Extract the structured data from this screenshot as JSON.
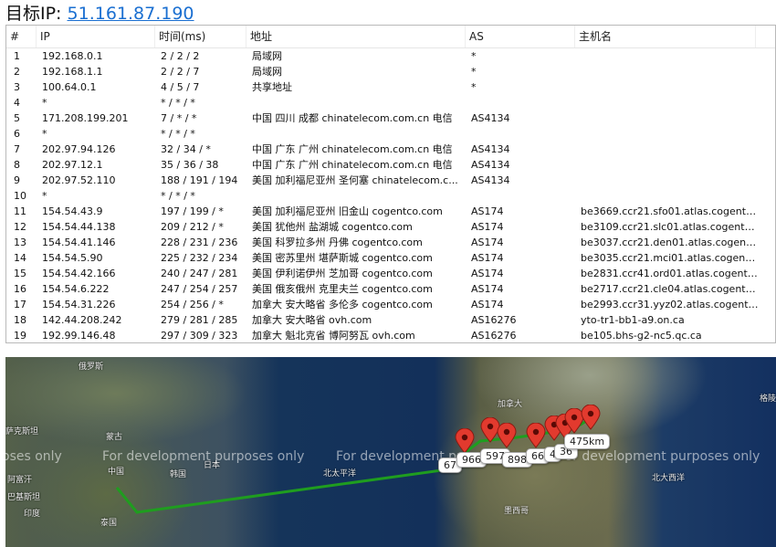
{
  "header": {
    "label": "目标IP:",
    "ip": "51.161.87.190"
  },
  "columns": [
    "#",
    "IP",
    "时间(ms)",
    "地址",
    "AS",
    "主机名"
  ],
  "rows": [
    {
      "idx": "1",
      "ip": "192.168.0.1",
      "time": "2 / 2 / 2",
      "location": "局域网",
      "as": "*",
      "host": ""
    },
    {
      "idx": "2",
      "ip": "192.168.1.1",
      "time": "2 / 2 / 7",
      "location": "局域网",
      "as": "*",
      "host": ""
    },
    {
      "idx": "3",
      "ip": "100.64.0.1",
      "time": "4 / 5 / 7",
      "location": "共享地址",
      "as": "*",
      "host": ""
    },
    {
      "idx": "4",
      "ip": "*",
      "time": "* / * / *",
      "location": "",
      "as": "",
      "host": ""
    },
    {
      "idx": "5",
      "ip": "171.208.199.201",
      "time": "7 / * / *",
      "location": "中国 四川 成都 chinatelecom.com.cn 电信",
      "as": "AS4134",
      "host": ""
    },
    {
      "idx": "6",
      "ip": "*",
      "time": "* / * / *",
      "location": "",
      "as": "",
      "host": ""
    },
    {
      "idx": "7",
      "ip": "202.97.94.126",
      "time": "32 / 34 / *",
      "location": "中国 广东 广州 chinatelecom.com.cn 电信",
      "as": "AS4134",
      "host": ""
    },
    {
      "idx": "8",
      "ip": "202.97.12.1",
      "time": "35 / 36 / 38",
      "location": "中国 广东 广州 chinatelecom.com.cn 电信",
      "as": "AS4134",
      "host": ""
    },
    {
      "idx": "9",
      "ip": "202.97.52.110",
      "time": "188 / 191 / 194",
      "location": "美国 加利福尼亚州 圣何塞 chinatelecom.c...",
      "as": "AS4134",
      "host": ""
    },
    {
      "idx": "10",
      "ip": "*",
      "time": "* / * / *",
      "location": "",
      "as": "",
      "host": ""
    },
    {
      "idx": "11",
      "ip": "154.54.43.9",
      "time": "197 / 199 / *",
      "location": "美国 加利福尼亚州 旧金山 cogentco.com",
      "as": "AS174",
      "host": "be3669.ccr21.sfo01.atlas.cogentco...."
    },
    {
      "idx": "12",
      "ip": "154.54.44.138",
      "time": "209 / 212 / *",
      "location": "美国 犹他州 盐湖城 cogentco.com",
      "as": "AS174",
      "host": "be3109.ccr21.slc01.atlas.cogentco...."
    },
    {
      "idx": "13",
      "ip": "154.54.41.146",
      "time": "228 / 231 / 236",
      "location": "美国 科罗拉多州 丹佛 cogentco.com",
      "as": "AS174",
      "host": "be3037.ccr21.den01.atlas.cogentco...."
    },
    {
      "idx": "14",
      "ip": "154.54.5.90",
      "time": "225 / 232 / 234",
      "location": "美国 密苏里州 堪萨斯城 cogentco.com",
      "as": "AS174",
      "host": "be3035.ccr21.mci01.atlas.cogentco...."
    },
    {
      "idx": "15",
      "ip": "154.54.42.166",
      "time": "240 / 247 / 281",
      "location": "美国 伊利诺伊州 芝加哥 cogentco.com",
      "as": "AS174",
      "host": "be2831.ccr41.ord01.atlas.cogentco...."
    },
    {
      "idx": "16",
      "ip": "154.54.6.222",
      "time": "247 / 254 / 257",
      "location": "美国 俄亥俄州 克里夫兰 cogentco.com",
      "as": "AS174",
      "host": "be2717.ccr21.cle04.atlas.cogentco...."
    },
    {
      "idx": "17",
      "ip": "154.54.31.226",
      "time": "254 / 256 / *",
      "location": "加拿大 安大略省 多伦多 cogentco.com",
      "as": "AS174",
      "host": "be2993.ccr31.yyz02.atlas.cogentco...."
    },
    {
      "idx": "18",
      "ip": "142.44.208.242",
      "time": "279 / 281 / 285",
      "location": "加拿大 安大略省 ovh.com",
      "as": "AS16276",
      "host": "yto-tr1-bb1-a9.on.ca"
    },
    {
      "idx": "19",
      "ip": "192.99.146.48",
      "time": "297 / 309 / 323",
      "location": "加拿大 魁北克省 博阿努瓦 ovh.com",
      "as": "AS16276",
      "host": "be105.bhs-g2-nc5.qc.ca"
    }
  ],
  "map": {
    "watermark": "For development purposes only",
    "watermark_left": "oses only",
    "labels": {
      "russia": "俄罗斯",
      "kazakhstan": "萨克斯坦",
      "mongolia": "蒙古",
      "china": "中国",
      "korea": "韩国",
      "japan": "日本",
      "afghanistan": "阿富汗",
      "pakistan": "巴基斯坦",
      "india": "印度",
      "thailand": "泰国",
      "north_pacific": "北太平洋",
      "canada": "加拿大",
      "mexico": "墨西哥",
      "north_atlantic": "北大西洋",
      "greenland": "格陵兰"
    },
    "distances": [
      "67",
      "966",
      "597",
      "898",
      "66",
      "4",
      "36",
      "475km"
    ],
    "colors": {
      "route": "#1f9d1f",
      "pin": "#e23a2e"
    }
  }
}
